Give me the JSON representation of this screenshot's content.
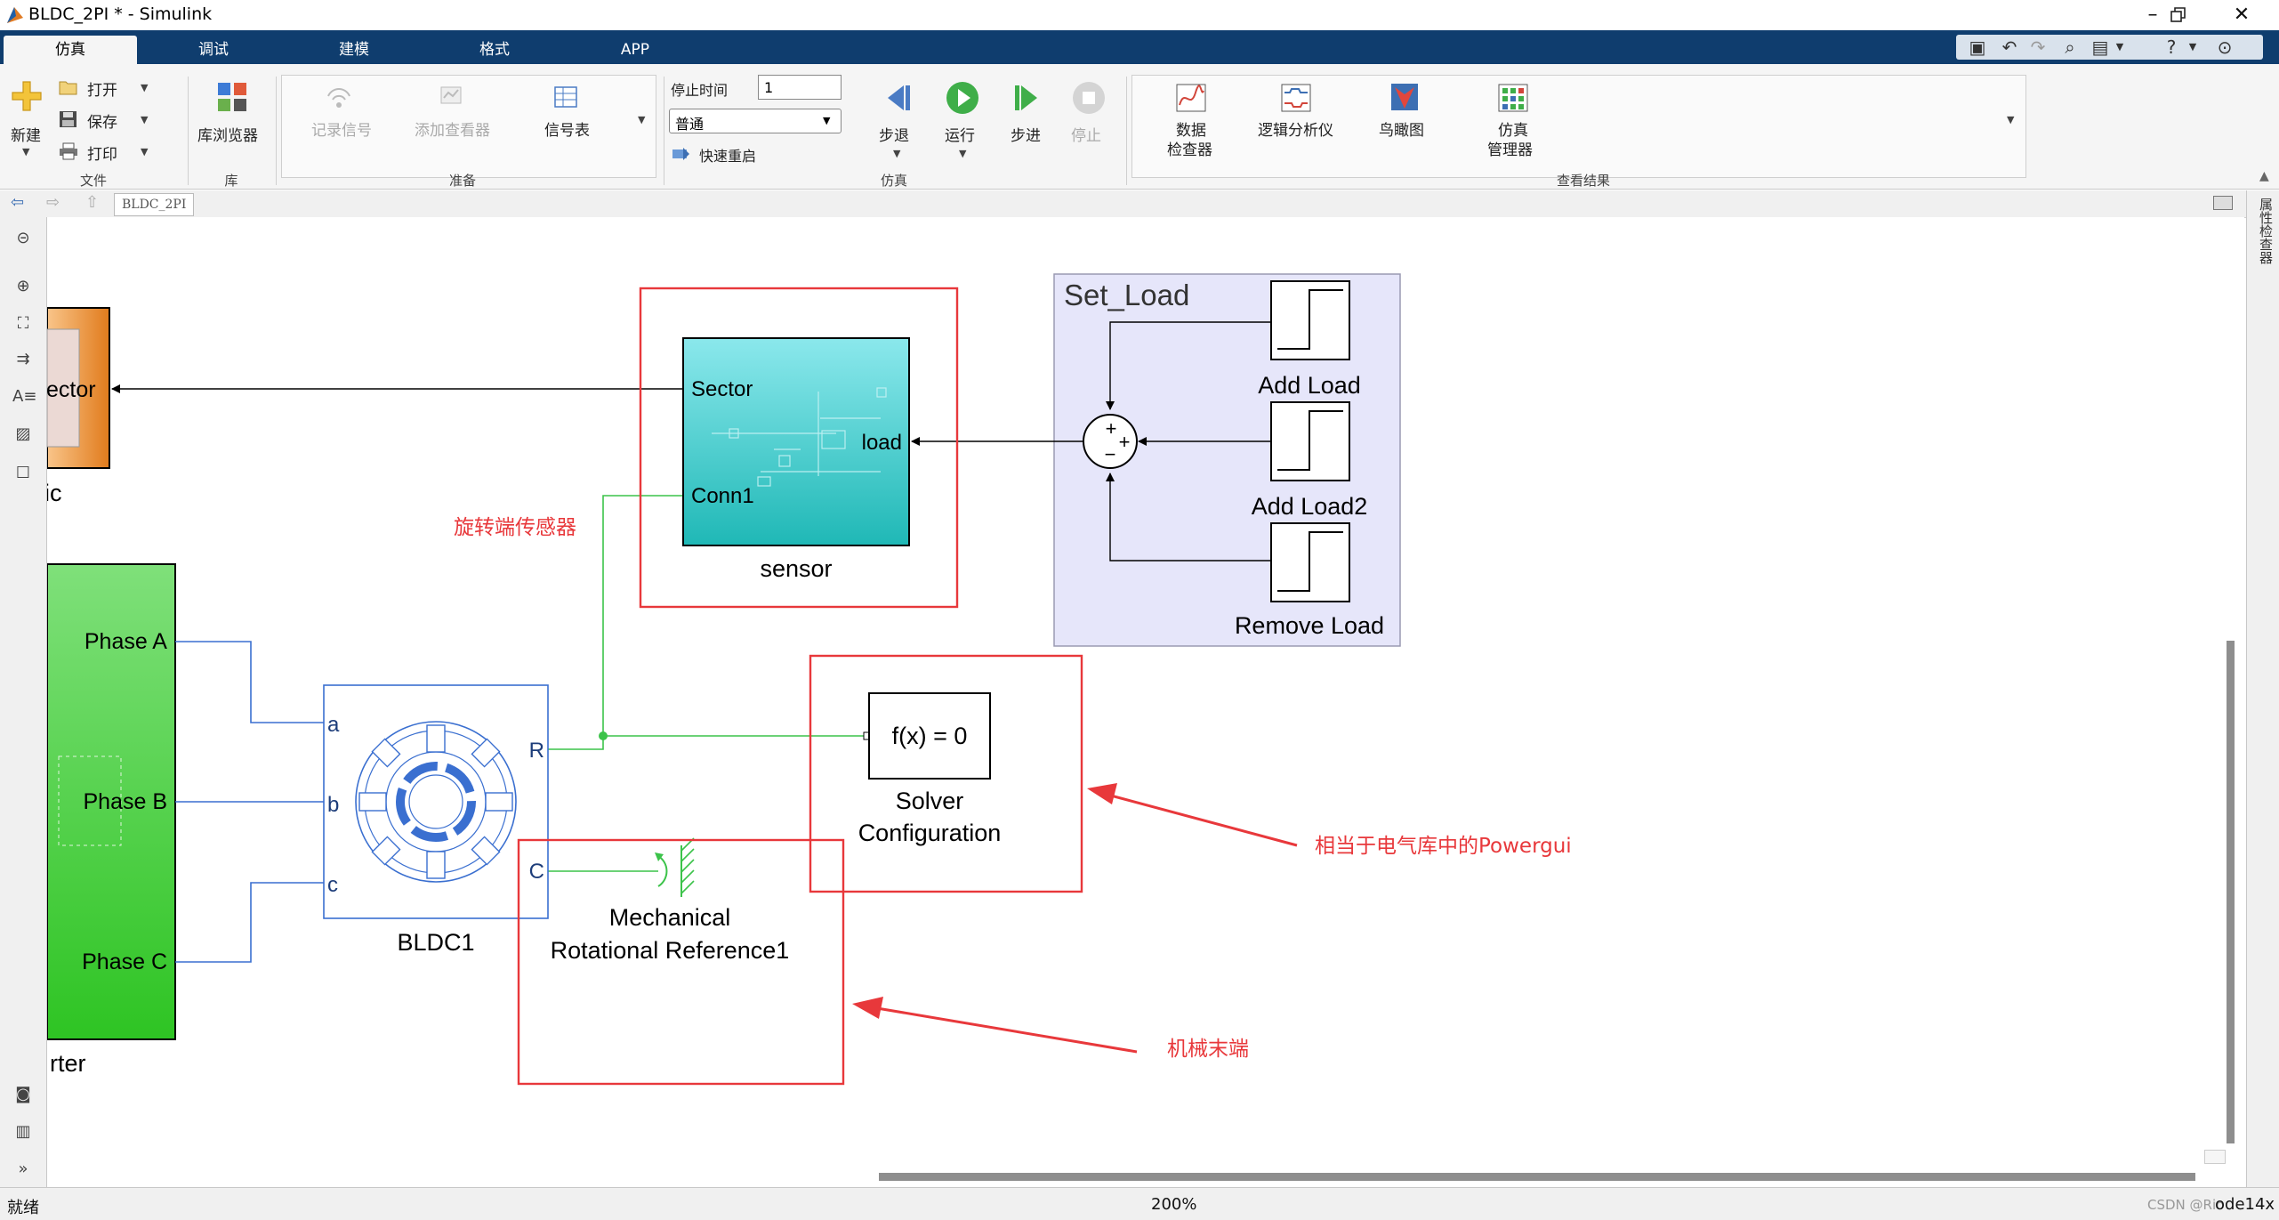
{
  "window": {
    "title": "BLDC_2PI * - Simulink"
  },
  "tabs": [
    {
      "label": "仿真",
      "active": true
    },
    {
      "label": "调试"
    },
    {
      "label": "建模"
    },
    {
      "label": "格式"
    },
    {
      "label": "APP"
    }
  ],
  "ribbon": {
    "file": {
      "new": "新建",
      "open": "打开",
      "save": "保存",
      "print": "打印",
      "group": "文件"
    },
    "library": {
      "browser": "库浏览器",
      "group": "库"
    },
    "prepare": {
      "log_signals": "记录信号",
      "add_viewer": "添加查看器",
      "signal_table": "信号表",
      "group": "准备"
    },
    "simulate": {
      "stop_time_label": "停止时间",
      "stop_time_value": "1",
      "mode": "普通",
      "fast_restart": "快速重启",
      "step_back": "步退",
      "run": "运行",
      "step_forward": "步进",
      "stop": "停止",
      "group": "仿真"
    },
    "review": {
      "data_inspector_1": "数据",
      "data_inspector_2": "检查器",
      "logic_analyzer": "逻辑分析仪",
      "birds_eye": "鸟瞰图",
      "sim_manager_1": "仿真",
      "sim_manager_2": "管理器",
      "group": "查看结果"
    }
  },
  "breadcrumb": {
    "model": "BLDC_2PI"
  },
  "side_panel": {
    "property_inspector": "属性检查器"
  },
  "diagram": {
    "logic_block": {
      "port": "ector",
      "caption": "jic"
    },
    "inverter_block": {
      "port_a": "Phase A",
      "port_b": "Phase B",
      "port_c": "Phase C",
      "caption": "rter"
    },
    "sensor_block": {
      "port_sector": "Sector",
      "port_load": "load",
      "port_conn1": "Conn1",
      "caption": "sensor"
    },
    "set_load": {
      "title": "Set_Load",
      "add_load": "Add Load",
      "add_load2": "Add Load2",
      "remove_load": "Remove Load",
      "sum_plus1": "+",
      "sum_plus2": "+",
      "sum_minus": "−"
    },
    "bldc": {
      "port_a": "a",
      "port_b": "b",
      "port_c": "c",
      "port_r": "R",
      "port_c_out": "C",
      "caption": "BLDC1"
    },
    "solver": {
      "expr": "f(x) = 0",
      "caption_1": "Solver",
      "caption_2": "Configuration"
    },
    "mech_ref": {
      "caption_1": "Mechanical",
      "caption_2": "Rotational Reference1"
    },
    "annotations": {
      "sensor": "旋转端传感器",
      "powergui": "相当于电气库中的Powergui",
      "mech_end": "机械末端"
    },
    "colors": {
      "annotation_red": "#e8383b",
      "wire_blue": "#3a6fd0",
      "wire_green": "#3cc34a"
    }
  },
  "status": {
    "ready": "就绪",
    "zoom": "200%",
    "watermark": "CSDN @Rio",
    "watermark2": "ode14x"
  }
}
